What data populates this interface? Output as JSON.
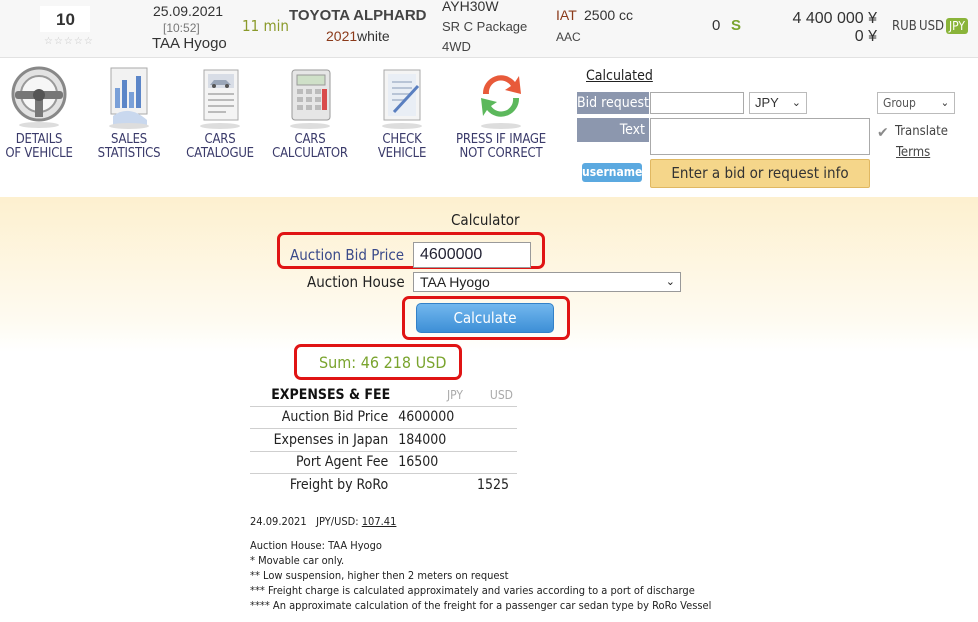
{
  "lot": {
    "number": "10",
    "rating_stars": "☆☆☆☆☆"
  },
  "auction": {
    "date": "25.09.2021",
    "time": "[10:52]",
    "name": "TAA Hyogo",
    "duration": "11 min"
  },
  "car": {
    "name": "TOYOTA ALPHARD",
    "year": "2021",
    "color": "white",
    "chassis": "AYH30W",
    "grade": "SR C Package",
    "drive": "4WD",
    "transmission": "IAT",
    "displacement": "2500 cc",
    "equipment": "AAC",
    "mileage": "0",
    "score": "S"
  },
  "prices": {
    "start": "4 400 000 ¥",
    "end": "0 ¥"
  },
  "currencies": {
    "rub": "RUB",
    "usd": "USD",
    "jpy": "JPY"
  },
  "tools": [
    {
      "line1": "DETAILS",
      "line2": "OF VEHICLE",
      "icon": "steering-wheel-icon"
    },
    {
      "line1": "SALES",
      "line2": "STATISTICS",
      "icon": "statistics-icon"
    },
    {
      "line1": "CARS",
      "line2": "CATALOGUE",
      "icon": "catalogue-icon"
    },
    {
      "line1": "CARS",
      "line2": "CALCULATOR",
      "icon": "calculator-icon"
    },
    {
      "line1": "CHECK",
      "line2": "VEHICLE",
      "icon": "checklist-icon"
    },
    {
      "line1": "PRESS IF IMAGE",
      "line2": "NOT CORRECT",
      "icon": "refresh-icon"
    }
  ],
  "bid_form": {
    "calculated_link": "Calculated",
    "bid_request_label": "Bid request",
    "bid_value": "",
    "currency": "JPY",
    "text_label": "Text",
    "text_value": "",
    "username": "username",
    "submit_label": "Enter a bid or request info",
    "group_select": "Group",
    "translate_label": "Translate",
    "terms_link": "Terms"
  },
  "calculator": {
    "title": "Calculator",
    "bid_price_label": "Auction Bid Price",
    "bid_price_value": "4600000",
    "auction_house_label": "Auction House",
    "auction_house_value": "TAA Hyogo",
    "calculate_label": "Calculate",
    "sum_label": "Sum:  46 218 USD"
  },
  "expenses": {
    "title": "EXPENSES & FEE",
    "col_jpy": "JPY",
    "col_usd": "USD",
    "rows": [
      {
        "name": "Auction Bid Price",
        "jpy": "4600000",
        "usd": ""
      },
      {
        "name": "Expenses in Japan",
        "jpy": "184000",
        "usd": ""
      },
      {
        "name": "Port Agent Fee",
        "jpy": "16500",
        "usd": ""
      },
      {
        "name": "Freight by RoRo",
        "jpy": "",
        "usd": "1525"
      }
    ]
  },
  "rate": {
    "date": "24.09.2021",
    "label": "JPY/USD:",
    "value": "107.41"
  },
  "notes": [
    "Auction House: TAA Hyogo",
    "* Movable car only.",
    "** Low suspension, higher then 2 meters on request",
    "*** Freight charge is calculated approximately and varies according to a port of discharge",
    "**** An approximate calculation of the freight for a passenger car sedan type by RoRo Vessel"
  ],
  "colors": {
    "accent_green": "#7aa42e",
    "highlight_red": "#e01414",
    "button_blue": "#3d8fd6",
    "label_slate": "#8c97ae"
  }
}
